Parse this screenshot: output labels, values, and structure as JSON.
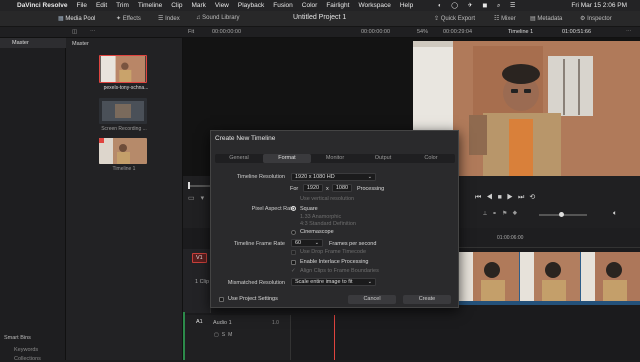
{
  "menubar": {
    "app_name": "DaVinci Resolve",
    "items": [
      "File",
      "Edit",
      "Trim",
      "Timeline",
      "Clip",
      "Mark",
      "View",
      "Playback",
      "Fusion",
      "Color",
      "Fairlight",
      "Workspace",
      "Help"
    ],
    "clock": "Fri Mar 15  2:06 PM"
  },
  "toolbar": {
    "media_pool": "Media Pool",
    "effects": "Effects",
    "index": "Index",
    "sound_library": "Sound Library",
    "project_title": "Untitled Project 1",
    "quick_export": "Quick Export",
    "mixer": "Mixer",
    "metadata": "Metadata",
    "inspector": "Inspector"
  },
  "subbar": {
    "fit": "Fit",
    "source_tc": "00:00:00:00",
    "record_tc": "00:00:00:00",
    "zoom": "54%",
    "duration_tc": "00:00:29:04",
    "timeline_name": "Timeline 1",
    "timeline_tc": "01:00:51:66"
  },
  "bins": {
    "master": "Master",
    "smart_bins": "Smart Bins",
    "keywords": "Keywords",
    "collections": "Collections"
  },
  "media": {
    "header": "Master",
    "clips": [
      {
        "name": "pexels-tony-schna..."
      },
      {
        "name": "Screen Recording ..."
      },
      {
        "name": "Timeline 1"
      }
    ]
  },
  "timeline": {
    "ruler_tc": "01:00:06:00",
    "video_track": "V1",
    "clip_count": "1 Clip",
    "audio_track": "A1",
    "audio_name": "Audio 1",
    "audio_level": "1.0"
  },
  "dialog": {
    "title": "Create New Timeline",
    "tabs": [
      "General",
      "Format",
      "Monitor",
      "Output",
      "Color"
    ],
    "active_tab": "Format",
    "timeline_resolution_label": "Timeline Resolution",
    "timeline_resolution_value": "1920 x 1080 HD",
    "for_label": "For",
    "width": "1920",
    "x_label": "x",
    "height": "1080",
    "processing_label": "Processing",
    "use_vertical": "Use vertical resolution",
    "pixel_aspect_label": "Pixel Aspect Ratio",
    "aspect_square": "Square",
    "aspect_anamorphic": "1.33 Anamorphic",
    "aspect_sd": "4:3 Standard Definition",
    "aspect_cinemascope": "Cinemascope",
    "frame_rate_label": "Timeline Frame Rate",
    "frame_rate_value": "60",
    "frame_rate_unit": "Frames per second",
    "use_drop_frame": "Use Drop Frame Timecode",
    "enable_interlace": "Enable Interlace Processing",
    "align_clips": "Align Clips to Frame Boundaries",
    "mismatched_label": "Mismatched Resolution",
    "mismatched_value": "Scale entire image to fit",
    "use_project_settings": "Use Project Settings",
    "cancel": "Cancel",
    "create": "Create"
  },
  "colors": {
    "accent_red": "#e0443f",
    "timeline_clip": "#2e5e8a",
    "dialog_bg": "#2a2a2c"
  }
}
